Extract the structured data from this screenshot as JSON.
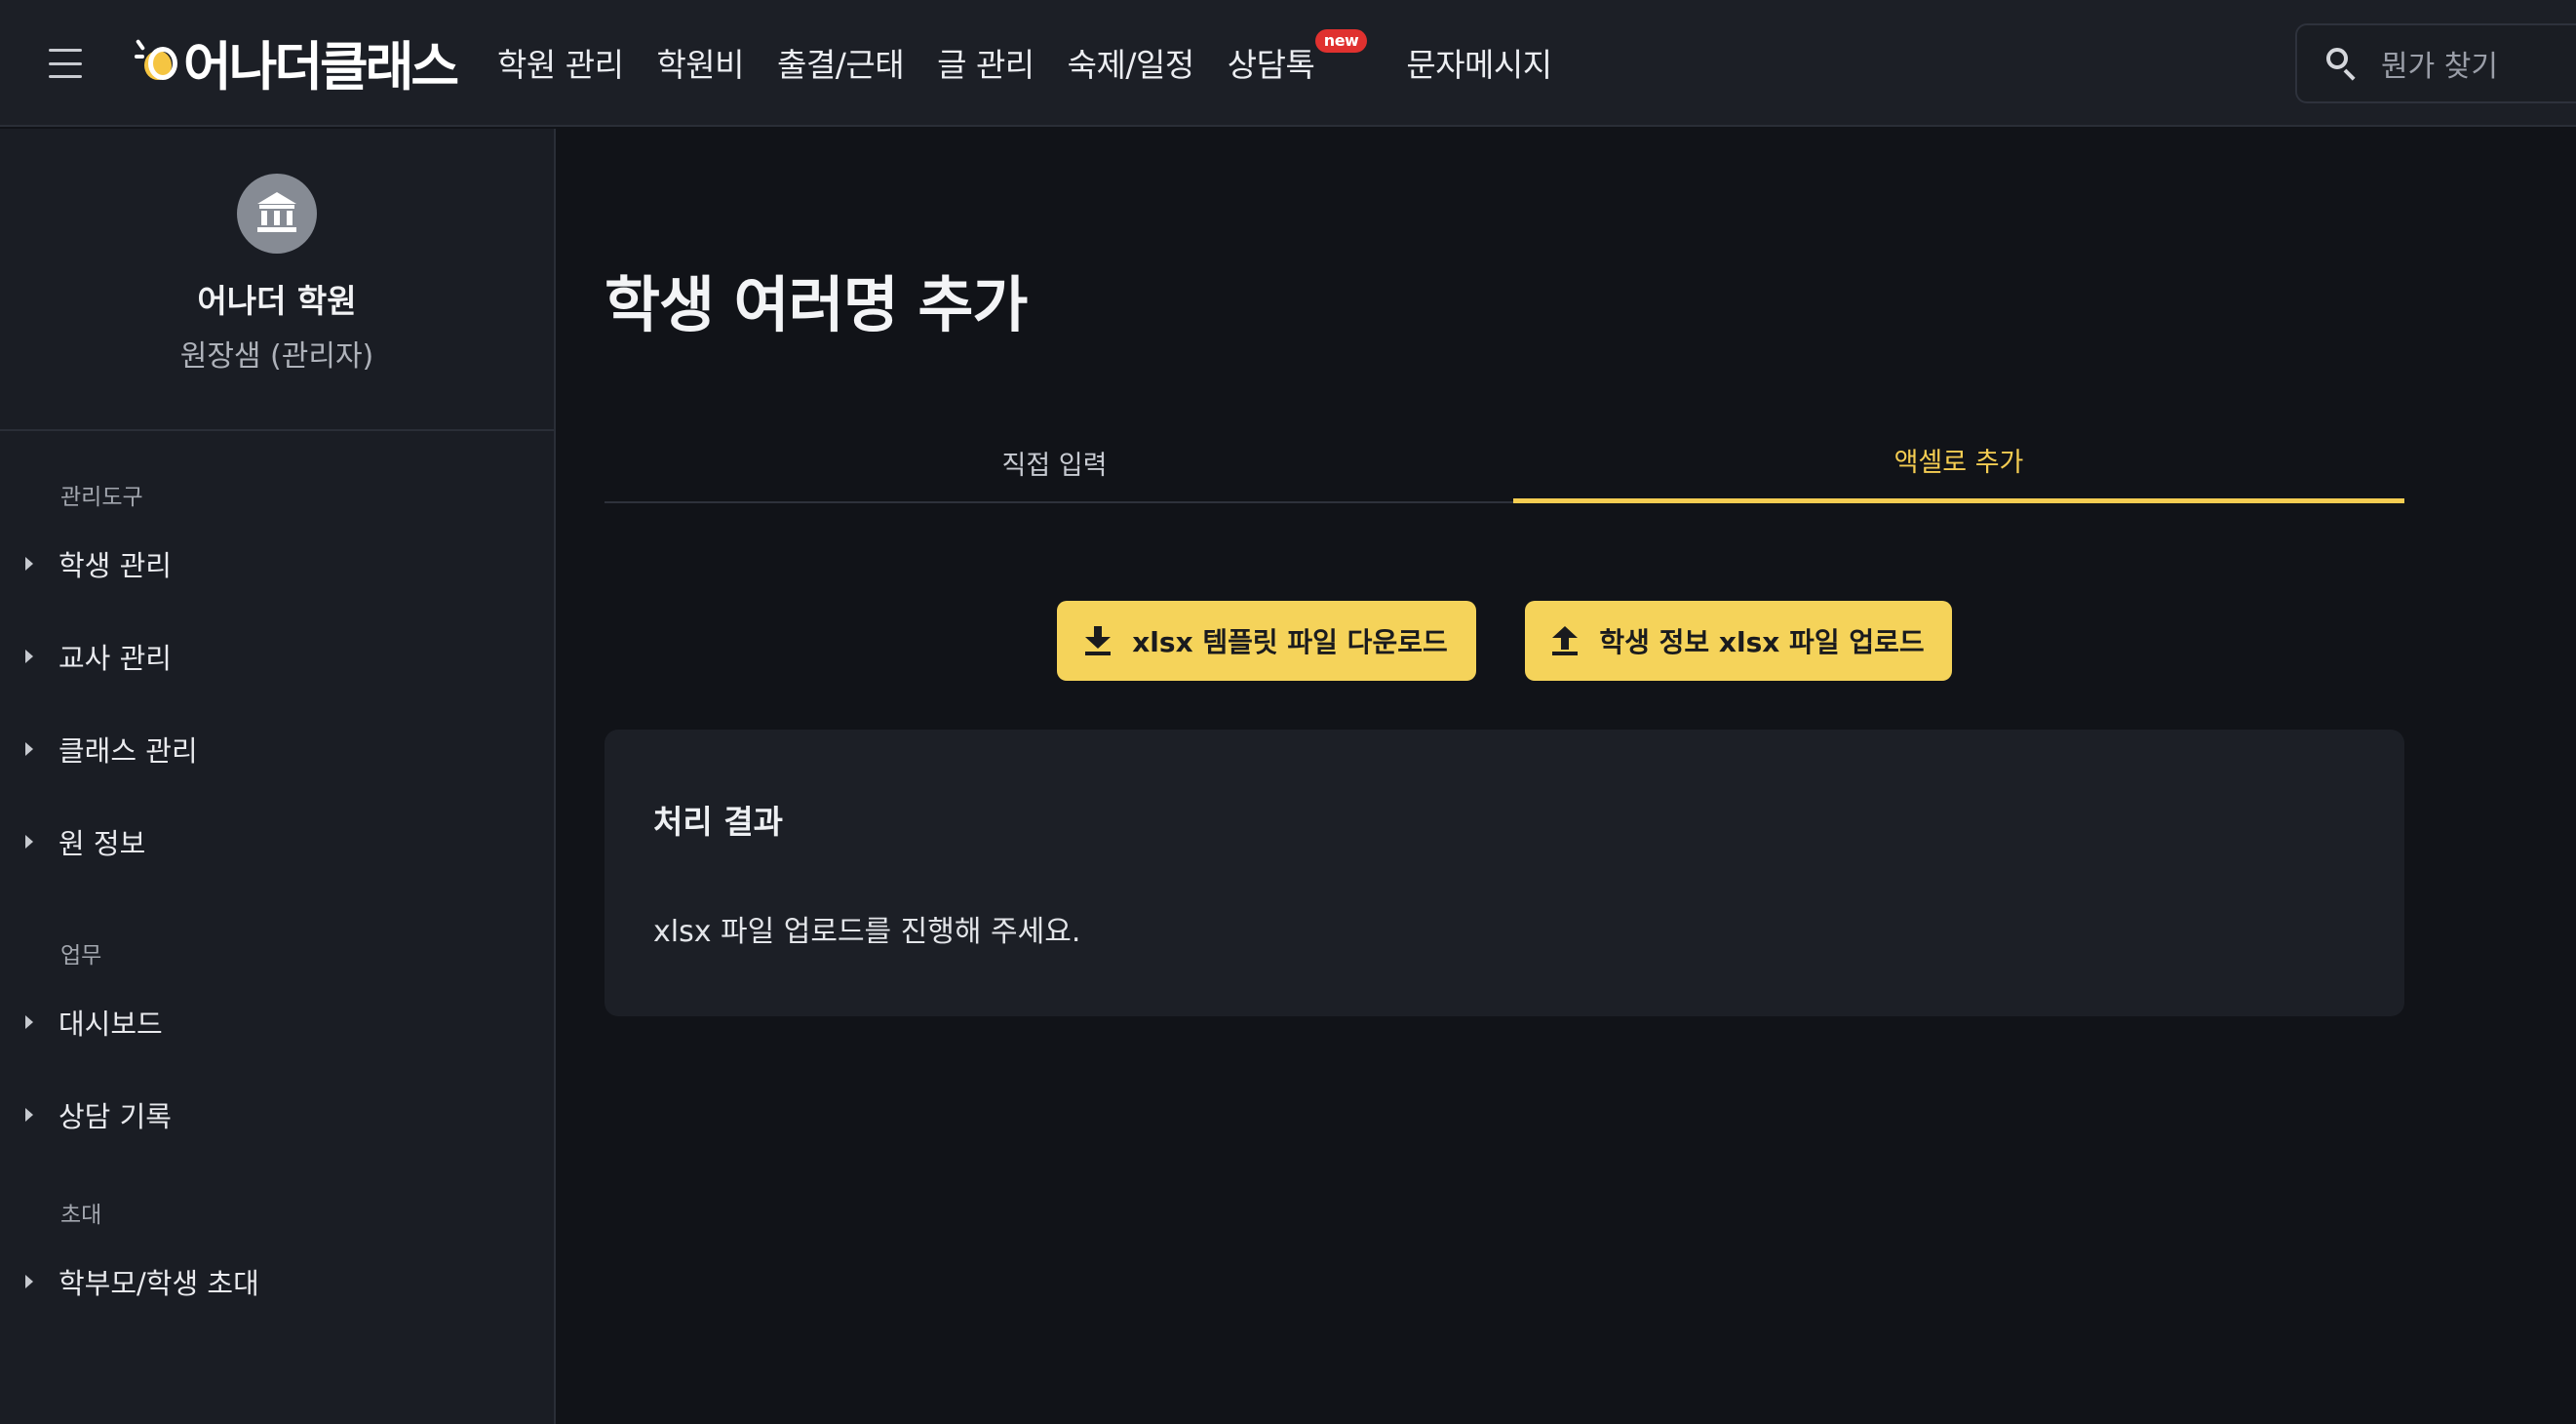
{
  "header": {
    "logo_text": "어나더클래스",
    "nav": [
      {
        "label": "학원 관리"
      },
      {
        "label": "학원비"
      },
      {
        "label": "출결/근태"
      },
      {
        "label": "글 관리"
      },
      {
        "label": "숙제/일정"
      },
      {
        "label": "상담톡",
        "badge": "new"
      },
      {
        "label": "문자메시지"
      }
    ],
    "search": {
      "placeholder": "뭔가 찾기"
    }
  },
  "sidebar": {
    "academy_name": "어나더 학원",
    "role": "원장샘 (관리자)",
    "sections": [
      {
        "label": "관리도구",
        "items": [
          "학생 관리",
          "교사 관리",
          "클래스 관리",
          "원 정보"
        ]
      },
      {
        "label": "업무",
        "items": [
          "대시보드",
          "상담 기록"
        ]
      },
      {
        "label": "초대",
        "items": [
          "학부모/학생 초대"
        ]
      }
    ]
  },
  "main": {
    "title": "학생 여러명 추가",
    "tabs": [
      {
        "label": "직접 입력",
        "active": false
      },
      {
        "label": "액셀로 추가",
        "active": true
      }
    ],
    "buttons": {
      "download": "xlsx 템플릿 파일 다운로드",
      "upload": "학생 정보 xlsx 파일 업로드"
    },
    "result": {
      "title": "처리 결과",
      "message": "xlsx 파일 업로드를 진행해 주세요."
    }
  },
  "colors": {
    "accent": "#f5d35a",
    "active_tab": "#f5cd52",
    "badge": "#e0312f",
    "background": "#111318",
    "panel": "#1c1f26"
  }
}
